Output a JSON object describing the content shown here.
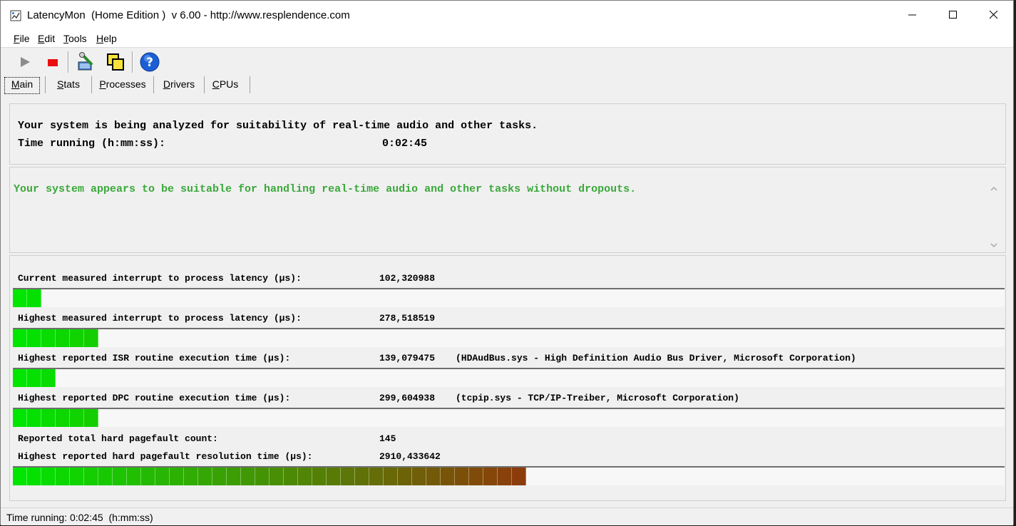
{
  "window": {
    "title": "LatencyMon  (Home Edition )  v 6.00 - http://www.resplendence.com"
  },
  "menu": [
    {
      "pre": "",
      "u": "F",
      "post": "ile"
    },
    {
      "pre": "",
      "u": "E",
      "post": "dit"
    },
    {
      "pre": "",
      "u": "T",
      "post": "ools"
    },
    {
      "pre": "",
      "u": "H",
      "post": "elp"
    }
  ],
  "toolbar": {
    "icons": [
      "play-icon",
      "stop-icon",
      "wrench-icon",
      "copy-windows-icon",
      "help-icon"
    ],
    "colors": {
      "stop": "#e81010",
      "help": "#1a5fd6",
      "play": "#8c8c8c"
    }
  },
  "tabs": [
    {
      "u": "M",
      "post": "ain"
    },
    {
      "u": "S",
      "post": "tats"
    },
    {
      "u": "P",
      "post": "rocesses"
    },
    {
      "u": "D",
      "post": "rivers"
    },
    {
      "u": "C",
      "post": "PUs"
    }
  ],
  "analysis": {
    "line1": "Your system is being analyzed for suitability of real-time audio and other tasks.",
    "time_label": "Time running (h:mm:ss):",
    "time_value": "0:02:45"
  },
  "verdict": {
    "text": "Your system appears to be suitable for handling real-time audio and other tasks without dropouts.",
    "color": "#3aa83a"
  },
  "metrics": {
    "m1": {
      "label": "Current measured interrupt to process latency (µs):",
      "value": "102,320988",
      "bar_segments": 2
    },
    "m2": {
      "label": "Highest measured interrupt to process latency (µs):",
      "value": "278,518519",
      "bar_segments": 6
    },
    "m3": {
      "label": "Highest reported ISR routine execution time (µs):",
      "value": "139,079475",
      "detail": "(HDAudBus.sys - High Definition Audio Bus Driver, Microsoft Corporation)",
      "bar_segments": 3
    },
    "m4": {
      "label": "Highest reported DPC routine execution time (µs):",
      "value": "299,604938",
      "detail": "(tcpip.sys - TCP/IP-Treiber, Microsoft Corporation)",
      "bar_segments": 6
    },
    "m5": {
      "label": "Reported total hard pagefault count:",
      "value": "145"
    },
    "m6": {
      "label": "Highest reported hard pagefault resolution time (µs):",
      "value": "2910,433642",
      "bar_segments": 36
    }
  },
  "statusbar": {
    "text": "Time running: 0:02:45  (h:mm:ss)"
  }
}
